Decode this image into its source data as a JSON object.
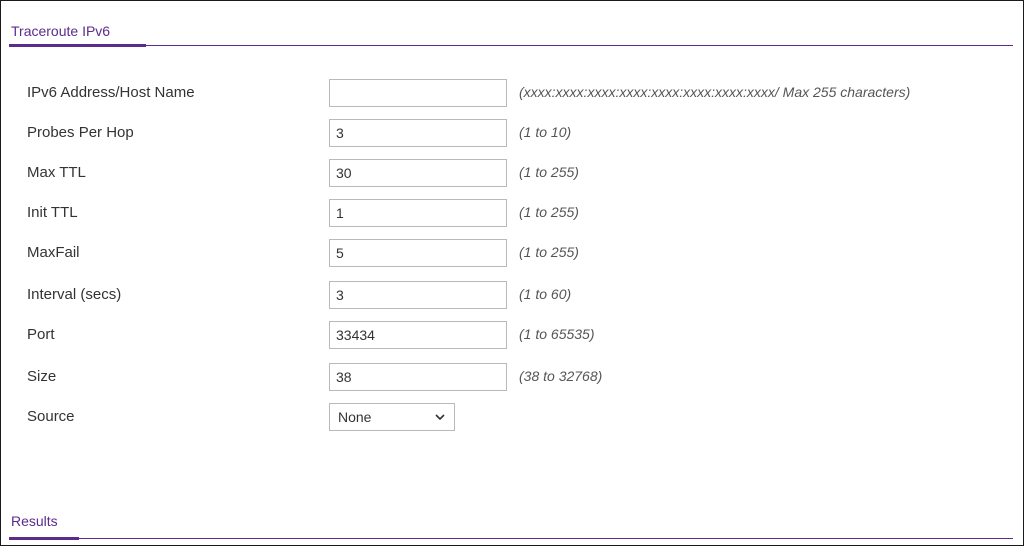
{
  "traceroute": {
    "title": "Traceroute IPv6"
  },
  "fields": [
    {
      "label": "IPv6 Address/Host Name",
      "value": "",
      "hint": "(xxxx:xxxx:xxxx:xxxx:xxxx:xxxx:xxxx:xxxx/ Max 255 characters)"
    },
    {
      "label": "Probes Per Hop",
      "value": "3",
      "hint": "(1 to 10)"
    },
    {
      "label": "Max TTL",
      "value": "30",
      "hint": "(1 to 255)"
    },
    {
      "label": "Init TTL",
      "value": "1",
      "hint": "(1 to 255)"
    },
    {
      "label": "MaxFail",
      "value": "5",
      "hint": "(1 to 255)"
    },
    {
      "label": "Interval (secs)",
      "value": "3",
      "hint": "(1 to 60)"
    },
    {
      "label": "Port",
      "value": "33434",
      "hint": "(1 to 65535)"
    },
    {
      "label": "Size",
      "value": "38",
      "hint": "(38 to 32768)"
    }
  ],
  "source": {
    "label": "Source",
    "selected": "None",
    "icon": "chevron-down-icon"
  },
  "results": {
    "title": "Results"
  },
  "colors": {
    "accent": "#5b2c8c",
    "border": "#b9b9b9",
    "text": "#333333"
  }
}
